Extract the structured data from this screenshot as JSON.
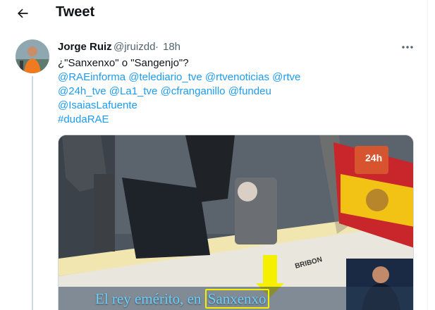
{
  "header": {
    "back_icon": "arrow-left-icon",
    "title": "Tweet"
  },
  "tweet": {
    "author_name": "Jorge Ruiz",
    "author_handle": "@jruizdd",
    "separator": "·",
    "timestamp": "18h",
    "more_icon": "more-horizontal-icon",
    "question": "¿\"Sanxenxo\" o \"Sangenjo\"?",
    "mentions_line1": [
      "@RAEinforma",
      "@telediario_tve",
      "@rtvenoticias",
      "@rtve"
    ],
    "mentions_line2": [
      "@24h_tve",
      "@La1_tve",
      "@cfranganillo",
      "@fundeu"
    ],
    "mentions_line3": [
      "@IsaiasLafuente"
    ],
    "hashtag": "#dudaRAE"
  },
  "media": {
    "channel_logo": "24h",
    "boat_name": "BRIBON",
    "caption_prefix": "El rey emérito, en ",
    "caption_highlight": "Sanxenxo",
    "accent_colors": {
      "link": "#1d9bf0",
      "caption": "#6ad0ff",
      "highlight": "#f5f000"
    }
  }
}
